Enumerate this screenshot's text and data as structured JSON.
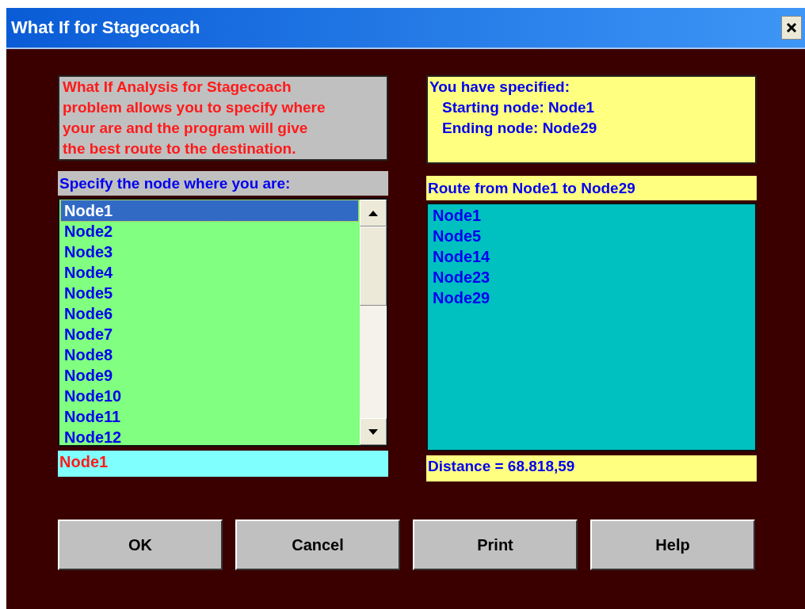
{
  "window": {
    "title": "What If for Stagecoach"
  },
  "description_lines": [
    "What If Analysis for Stagecoach",
    "problem allows you to specify where",
    "your are and the program will give",
    "the best route to the destination."
  ],
  "specified": {
    "heading": "You have specified:",
    "lines": [
      "Starting node: Node1",
      "Ending node: Node29"
    ]
  },
  "node_list": {
    "label": "Specify the node where you are:",
    "items": [
      {
        "text": "Node1",
        "selected": true
      },
      {
        "text": "Node2",
        "selected": false
      },
      {
        "text": "Node3",
        "selected": false
      },
      {
        "text": "Node4",
        "selected": false
      },
      {
        "text": "Node5",
        "selected": false
      },
      {
        "text": "Node6",
        "selected": false
      },
      {
        "text": "Node7",
        "selected": false
      },
      {
        "text": "Node8",
        "selected": false
      },
      {
        "text": "Node9",
        "selected": false
      },
      {
        "text": "Node10",
        "selected": false
      },
      {
        "text": "Node11",
        "selected": false
      },
      {
        "text": "Node12",
        "selected": false
      }
    ]
  },
  "current_node": "Node1",
  "route": {
    "label": "Route from Node1 to Node29",
    "nodes": [
      "Node1",
      "Node5",
      "Node14",
      "Node23",
      "Node29"
    ]
  },
  "distance": "Distance = 68.818,59",
  "buttons": [
    "OK",
    "Cancel",
    "Print",
    "Help"
  ]
}
